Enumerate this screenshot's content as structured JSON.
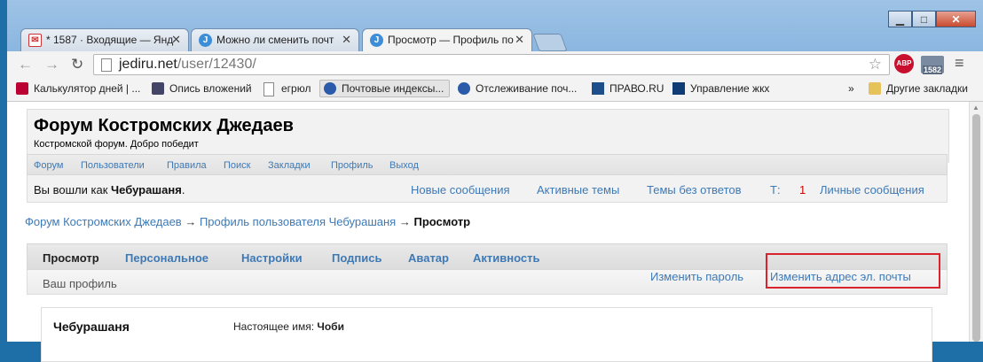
{
  "browser": {
    "tabs": [
      {
        "title": "* 1587 · Входящие — Янд",
        "icon": "mail-icon"
      },
      {
        "title": "Можно ли сменить почт",
        "icon": "j-icon"
      },
      {
        "title": "Просмотр — Профиль по",
        "icon": "j-icon",
        "active": true
      }
    ],
    "address": {
      "host": "jediru.net",
      "path": "/user/12430/"
    },
    "ext_abp": "ABP",
    "ext_mail_count": "1582",
    "bookmarks": [
      "Калькулятор дней | ...",
      "Опись вложений",
      "егрюл",
      "Почтовые индексы...",
      "Отслеживание поч...",
      "ПРАВО.RU",
      "Управление жкх"
    ],
    "more_bookmarks": "»",
    "other_bookmarks": "Другие закладки"
  },
  "forum": {
    "title": "Форум Костромских Джедаев",
    "description": "Костромской форум. Добро победит",
    "menu": [
      "Форум",
      "Пользователи",
      "Правила",
      "Поиск",
      "Закладки",
      "Профиль",
      "Выход"
    ],
    "logged_prefix": "Вы вошли как ",
    "username": "Чебурашаня",
    "logged_suffix": ".",
    "links": {
      "new_posts": "Новые сообщения",
      "active_topics": "Активные темы",
      "unanswered": "Темы без ответов",
      "t_label": "Т:",
      "t_count": "1",
      "messages": "Личные сообщения"
    }
  },
  "breadcrumb": {
    "root": "Форум Костромских Джедаев",
    "sep": " → ",
    "profile": "Профиль пользователя Чебурашаня",
    "current": "Просмотр"
  },
  "profile_nav": {
    "tabs": [
      "Просмотр",
      "Персональное",
      "Настройки",
      "Подпись",
      "Аватар",
      "Активность"
    ],
    "sub_label": "Ваш профиль",
    "change_password": "Изменить пароль",
    "change_email": "Изменить адрес эл. почты"
  },
  "profile_card": {
    "name": "Чебурашаня",
    "real_name_label": "Настоящее имя: ",
    "real_name": "Чоби"
  }
}
